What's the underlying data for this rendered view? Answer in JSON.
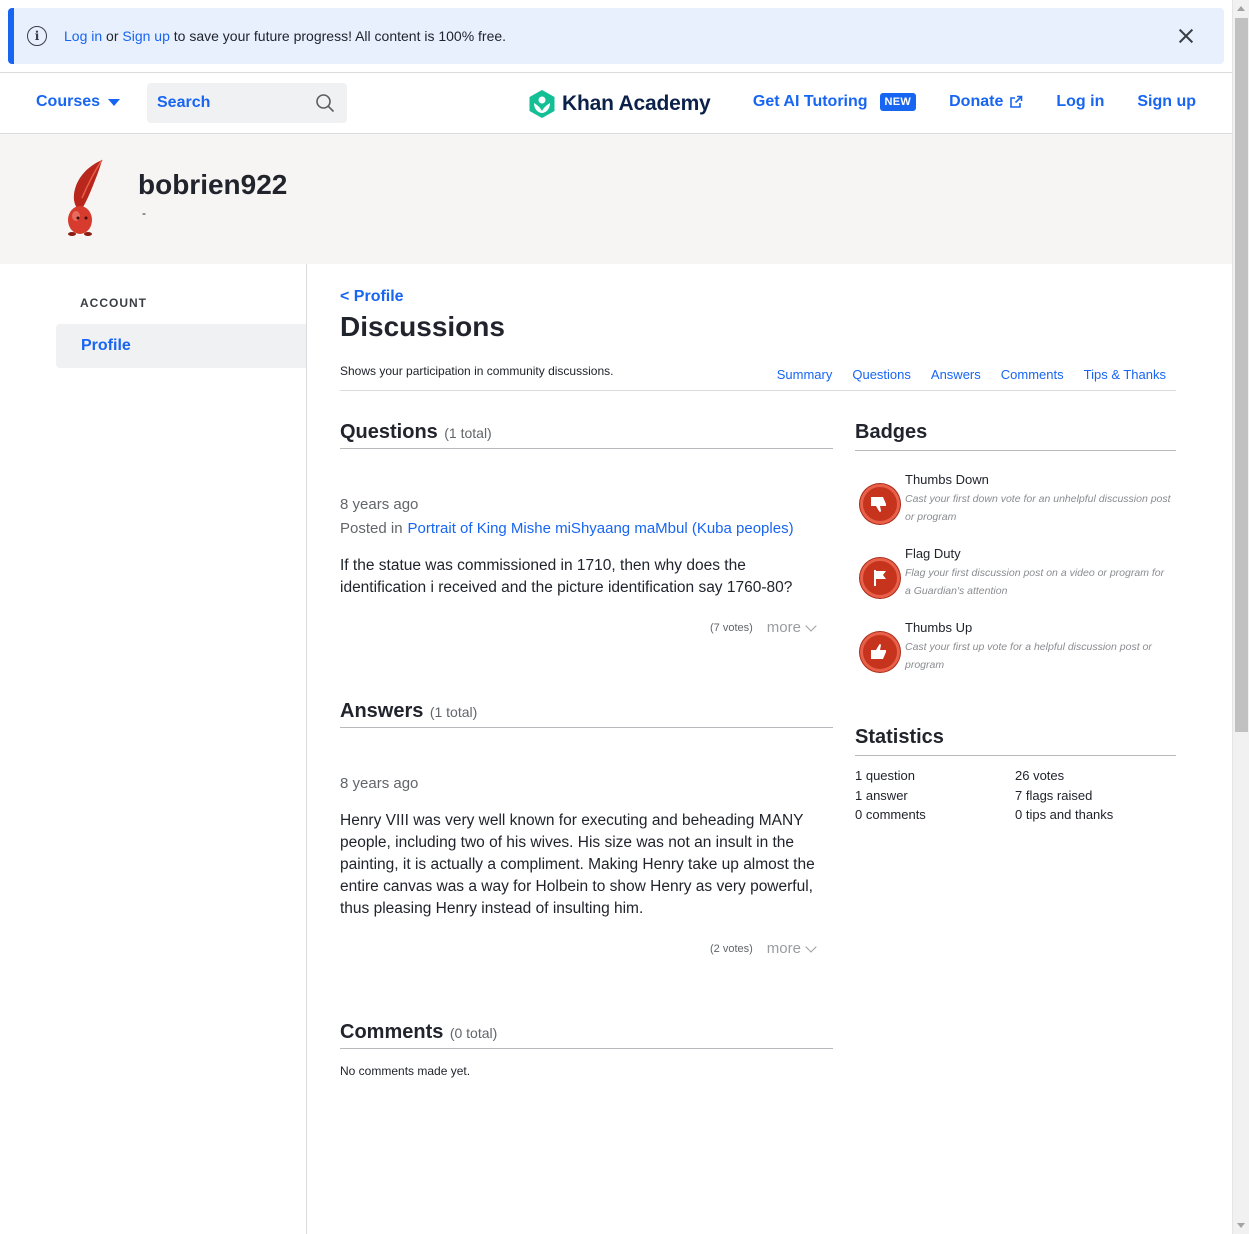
{
  "banner": {
    "login_link": "Log in",
    "or_text": "or",
    "signup_link": "Sign up",
    "message": "to save your future progress! All content is 100% free."
  },
  "header": {
    "courses_label": "Courses",
    "search_placeholder": "Search",
    "logo_text": "Khan Academy",
    "ai_tutoring_label": "Get AI Tutoring",
    "new_badge": "NEW",
    "donate_label": "Donate",
    "login_label": "Log in",
    "signup_label": "Sign up"
  },
  "profile": {
    "username": "bobrien922",
    "tagline": "-"
  },
  "sidebar": {
    "section_label": "ACCOUNT",
    "items": [
      {
        "label": "Profile"
      }
    ]
  },
  "main": {
    "back_link": "< Profile",
    "title": "Discussions",
    "subtitle": "Shows your participation in community discussions.",
    "tabs": [
      {
        "label": "Summary"
      },
      {
        "label": "Questions"
      },
      {
        "label": "Answers"
      },
      {
        "label": "Comments"
      },
      {
        "label": "Tips & Thanks"
      }
    ],
    "questions": {
      "heading": "Questions",
      "total": "(1 total)",
      "items": [
        {
          "time": "8 years ago",
          "posted_in_label": "Posted in",
          "posted_in_link": "Portrait of King Mishe miShyaang maMbul (Kuba peoples)",
          "text": "If the statue was commissioned in 1710, then why does the identification i received and the picture identification say 1760-80?",
          "votes": "(7 votes)",
          "more": "more"
        }
      ]
    },
    "answers": {
      "heading": "Answers",
      "total": "(1 total)",
      "items": [
        {
          "time": "8 years ago",
          "text": "Henry VIII was very well known for executing and beheading MANY people, including two of his wives. His size was not an insult in the painting, it is actually a compliment. Making Henry take up almost the entire canvas was a way for Holbein to show Henry as very powerful, thus pleasing Henry instead of insulting him.",
          "votes": "(2 votes)",
          "more": "more"
        }
      ]
    },
    "comments": {
      "heading": "Comments",
      "total": "(0 total)",
      "empty_text": "No comments made yet."
    }
  },
  "badges": {
    "heading": "Badges",
    "items": [
      {
        "name": "Thumbs Down",
        "description": "Cast your first down vote for an unhelpful discussion post or program",
        "icon": "thumbs-down-icon"
      },
      {
        "name": "Flag Duty",
        "description": "Flag your first discussion post on a video or program for a Guardian's attention",
        "icon": "flag-icon"
      },
      {
        "name": "Thumbs Up",
        "description": "Cast your first up vote for a helpful discussion post or program",
        "icon": "thumbs-up-icon"
      }
    ]
  },
  "statistics": {
    "heading": "Statistics",
    "items": [
      "1 question",
      "26 votes",
      "1 answer",
      "7 flags raised",
      "0 comments",
      "0 tips and thanks"
    ]
  },
  "colors": {
    "accent": "#1865f2",
    "badge_red": "#c6341d",
    "logo_green": "#14bf96"
  }
}
